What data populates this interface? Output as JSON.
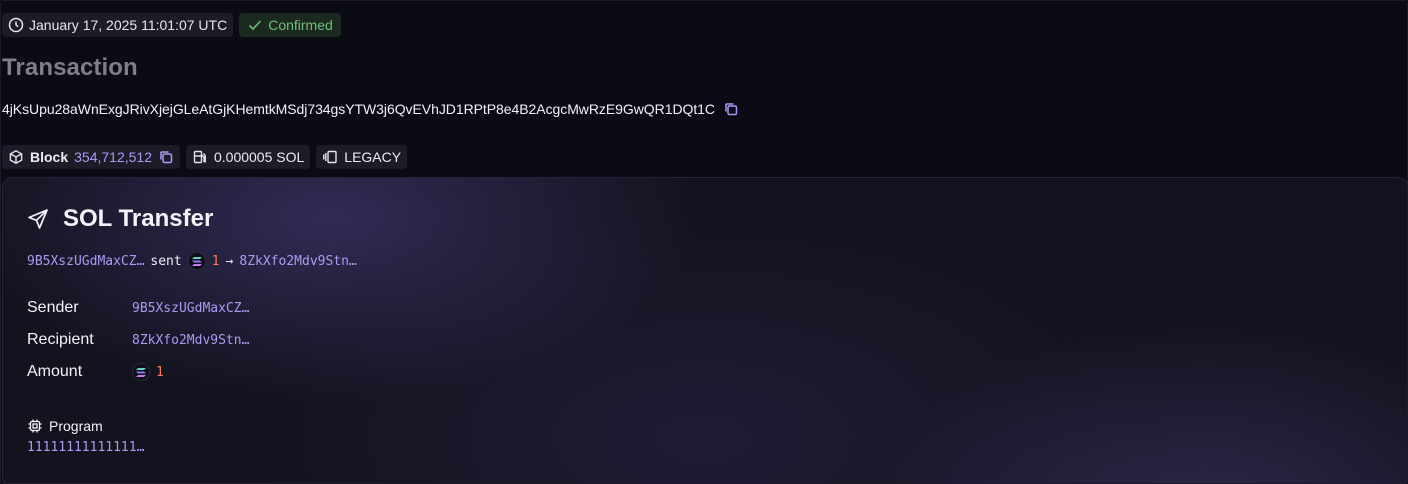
{
  "header": {
    "timestamp": "January 17, 2025 11:01:07 UTC",
    "status": "Confirmed",
    "title": "Transaction",
    "signature": "4jKsUpu28aWnExgJRivXjejGLeAtGjKHemtkMSdj734gsYTW3j6QvEVhJD1RPtP8e4B2AcgcMwRzE9GwQR1DQt1C"
  },
  "chips": {
    "block_label": "Block",
    "block_value": "354,712,512",
    "fee": "0.000005 SOL",
    "version": "LEGACY"
  },
  "card": {
    "title": "SOL Transfer",
    "summary": {
      "from": "9B5XszUGdMaxCZ…",
      "verb": "sent",
      "amount": "1",
      "arrow": "→",
      "to": "8ZkXfo2Mdv9Stn…"
    },
    "details": [
      {
        "label": "Sender",
        "value": "9B5XszUGdMaxCZ…"
      },
      {
        "label": "Recipient",
        "value": "8ZkXfo2Mdv9Stn…"
      },
      {
        "label": "Amount",
        "value": "1"
      }
    ],
    "program_label": "Program",
    "program_value": "11111111111111…"
  },
  "icons": {
    "clock": "clock-icon",
    "check": "check-icon",
    "copy": "copy-icon",
    "cube": "cube-icon",
    "fuel": "fuel-icon",
    "version": "layers-icon",
    "send": "send-icon",
    "solana": "solana-icon",
    "chip": "cpu-icon"
  },
  "colors": {
    "background": "#0b0b16",
    "confirmed": "#6fbf7c",
    "address": "#a99bf3",
    "amount": "#ff7a52",
    "muted_title": "#7f7f8c"
  }
}
